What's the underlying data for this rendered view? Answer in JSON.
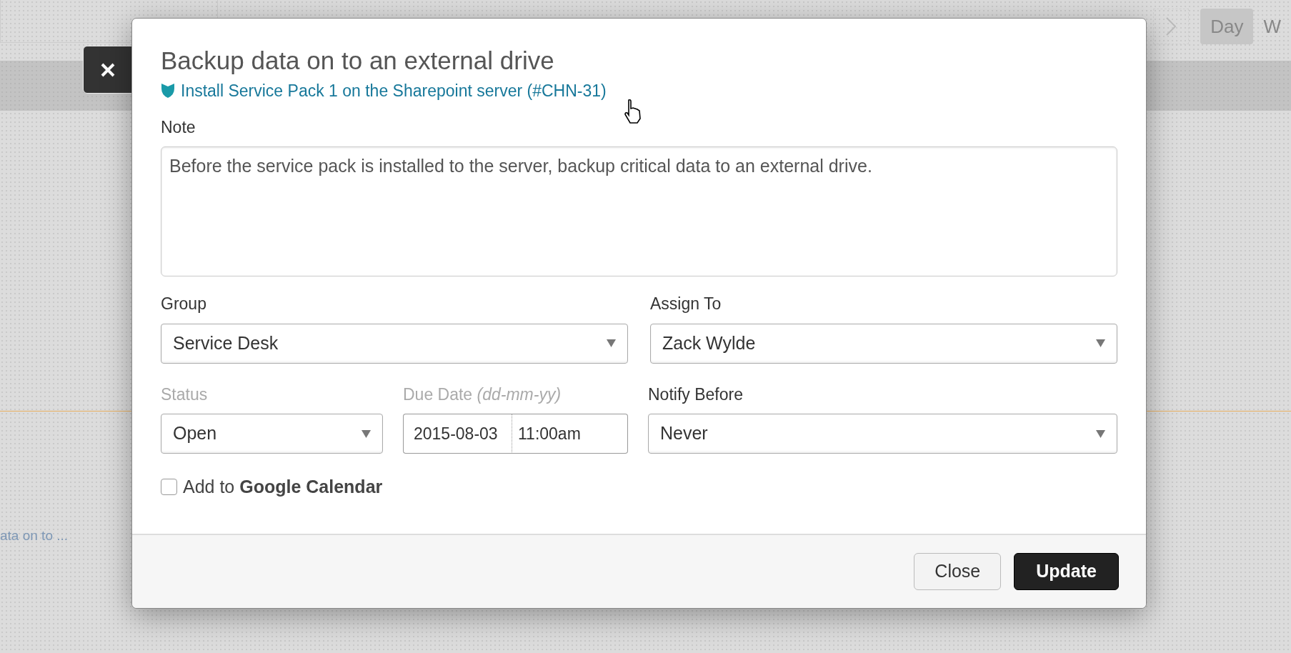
{
  "background": {
    "views": [
      {
        "label": "Day",
        "selected": true
      },
      {
        "label": "W",
        "selected": false
      }
    ],
    "event_text": "ata on to ..."
  },
  "dialog": {
    "title": "Backup data on to an external drive",
    "link": "Install Service Pack 1 on the Sharepoint server (#CHN-31)",
    "note": {
      "label": "Note",
      "value": "Before the service pack is installed to the server, backup critical data to an external drive."
    },
    "fields": [
      {
        "kind": "select",
        "label": "Group",
        "value": "Service Desk",
        "disabled": false
      },
      {
        "kind": "select",
        "label": "Assign To",
        "value": "Zack Wylde",
        "disabled": false
      },
      {
        "kind": "select",
        "label": "Status",
        "value": "Open",
        "disabled": true
      },
      {
        "kind": "datetime",
        "label": "Due Date  *(dd-mm-yy)*",
        "date": "2015-08-03",
        "time": "11:00am",
        "disabled": true
      },
      {
        "kind": "select",
        "label": "Notify Before",
        "value": "Never",
        "disabled": false
      }
    ],
    "checkbox": {
      "label": "Add to **Google Calendar**",
      "checked": false
    },
    "buttons": [
      {
        "label": "Close",
        "kind": "secondary"
      },
      {
        "label": "Update",
        "kind": "primary"
      }
    ]
  }
}
